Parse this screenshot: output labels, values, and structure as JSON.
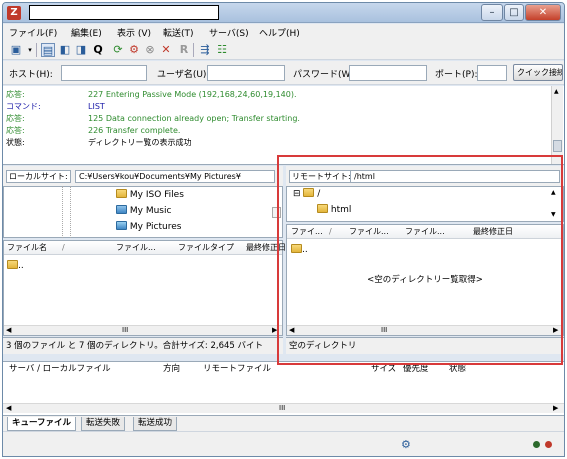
{
  "menu": [
    "ファイル(F)",
    "編集(E)",
    "表示 (V)",
    "転送(T)",
    "サーバ(S)",
    "ヘルプ(H)"
  ],
  "quickconnect": {
    "host_label": "ホスト(H):",
    "user_label": "ユーザ名(U):",
    "password_label": "パスワード(W):",
    "port_label": "ポート(P):",
    "button_label": "クイック接続"
  },
  "log": [
    {
      "kind": "応答:",
      "text": "227 Entering Passive Mode (192,168,24,60,19,140).",
      "color": "#2e8b2e"
    },
    {
      "kind": "コマンド:",
      "text": "LIST",
      "color": "#1a1aa8"
    },
    {
      "kind": "応答:",
      "text": "125 Data connection already open; Transfer starting.",
      "color": "#2e8b2e"
    },
    {
      "kind": "応答:",
      "text": "226 Transfer complete.",
      "color": "#2e8b2e"
    },
    {
      "kind": "状態:",
      "text": "ディレクトリー覧の表示成功",
      "color": "#000000"
    }
  ],
  "local": {
    "site_label": "ローカルサイト:",
    "path": "C:¥Users¥kou¥Documents¥My Pictures¥",
    "tree": [
      "My ISO Files",
      "My Music",
      "My Pictures"
    ],
    "columns": [
      "ファイル名",
      "ファイル...",
      "ファイルタイプ",
      "最終修正日"
    ],
    "files": [
      ".."
    ],
    "status": "3 個のファイル と 7 個のディレクトリ。合計サイズ: 2,645 バイト"
  },
  "remote": {
    "site_label": "リモートサイト:",
    "path": "/html",
    "tree": [
      "/",
      "html"
    ],
    "columns": [
      "ファイ...",
      "ファイル...",
      "ファイル...",
      "最終修正日"
    ],
    "files": [
      ".."
    ],
    "empty_message": "<空のディレクトリー覧取得>",
    "status": "空のディレクトリ"
  },
  "queue": {
    "columns": [
      "サーバ / ローカルファイル",
      "方向",
      "リモートファイル",
      "サイズ",
      "優先度",
      "状態"
    ],
    "tabs": [
      "キューファイル",
      "転送失敗",
      "転送成功"
    ]
  },
  "colors": {
    "highlight": "#d83a3a"
  }
}
